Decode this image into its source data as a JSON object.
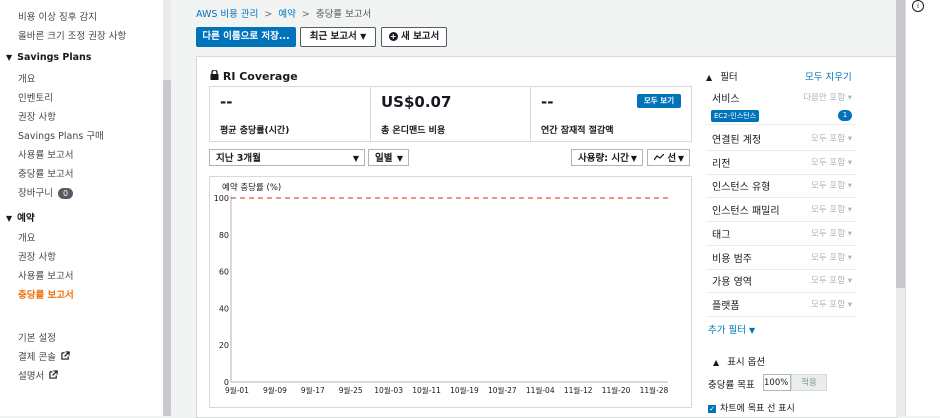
{
  "sidebar": {
    "cost_items": [
      "비용 이상 징후 감지",
      "올바른 크기 조정 권장 사항"
    ],
    "sp_head": "Savings Plans",
    "sp_items": [
      "개요",
      "인벤토리",
      "권장 사항",
      "Savings Plans 구매",
      "사용률 보고서",
      "충당률 보고서",
      "장바구니"
    ],
    "cart_count": "0",
    "res_head": "예약",
    "res_items": [
      "개요",
      "권장 사항",
      "사용률 보고서",
      "충당률 보고서"
    ],
    "bottom_items": [
      "기본 설정",
      "결제 콘솔",
      "설명서"
    ]
  },
  "breadcrumb": {
    "root": "AWS 비용 관리",
    "mid": "예약",
    "current": "충당률 보고서",
    "sep": ">"
  },
  "toolbar": {
    "save_as": "다른 이름으로 저장...",
    "recent": "최근 보고서",
    "new": "새 보고서"
  },
  "report": {
    "title": "RI Coverage",
    "kpis": [
      {
        "value": "--",
        "label": "평균 충당률(시간)"
      },
      {
        "value": "US$0.07",
        "label": "총 온디맨드 비용"
      },
      {
        "value": "--",
        "label": "연간 잠재적 절감액"
      }
    ],
    "view_all": "모두 보기",
    "range": "지난 3개월",
    "granularity": "일별",
    "usage": "사용량: 시간",
    "chart_style": "선"
  },
  "chart_data": {
    "type": "line",
    "ylabel": "예약 충당률 (%)",
    "ylim": [
      0,
      100
    ],
    "yticks": [
      0,
      20,
      40,
      60,
      80,
      100
    ],
    "categories": [
      "9월-01",
      "9월-09",
      "9월-17",
      "9월-25",
      "10월-03",
      "10월-11",
      "10월-19",
      "10월-27",
      "11월-04",
      "11월-12",
      "11월-20",
      "11월-28"
    ],
    "series": [],
    "target_line": 100,
    "target_color": "#d13212",
    "grid": true
  },
  "filters": {
    "header": "필터",
    "clear_all": "모두 지우기",
    "rows": [
      {
        "name": "서비스",
        "hint": "다음만 포함"
      },
      {
        "name": "연결된 계정",
        "hint": "모두 포함"
      },
      {
        "name": "리전",
        "hint": "모두 포함"
      },
      {
        "name": "인스턴스 유형",
        "hint": "모두 포함"
      },
      {
        "name": "인스턴스 패밀리",
        "hint": "모두 포함"
      },
      {
        "name": "태그",
        "hint": "모두 포함"
      },
      {
        "name": "비용 범주",
        "hint": "모두 포함"
      },
      {
        "name": "가용 영역",
        "hint": "모두 포함"
      },
      {
        "name": "플랫폼",
        "hint": "모두 포함"
      }
    ],
    "service_chip": "EC2-인스턴스",
    "service_count": "1",
    "more": "추가 필터"
  },
  "display": {
    "header": "표시 옵션",
    "target_label": "충당률 목표",
    "target_value": "100%",
    "apply": "적용",
    "show_target": "차트에 목표 선 표시"
  }
}
